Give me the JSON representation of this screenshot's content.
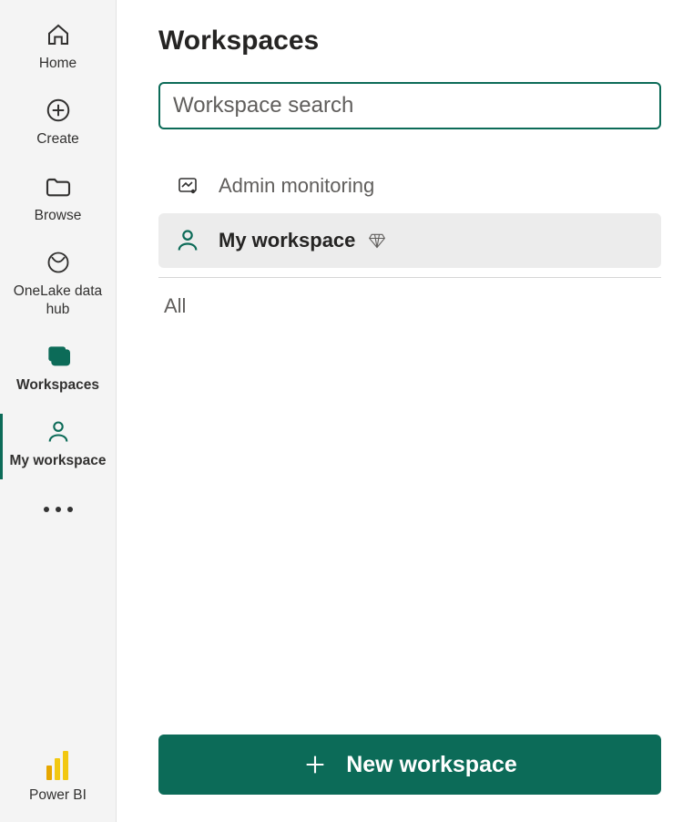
{
  "sidebar": {
    "items": [
      {
        "label": "Home"
      },
      {
        "label": "Create"
      },
      {
        "label": "Browse"
      },
      {
        "label": "OneLake data hub"
      },
      {
        "label": "Workspaces"
      },
      {
        "label": "My workspace"
      }
    ],
    "brand_label": "Power BI"
  },
  "panel": {
    "title": "Workspaces",
    "search_placeholder": "Workspace search",
    "items": [
      {
        "label": "Admin monitoring"
      },
      {
        "label": "My workspace"
      }
    ],
    "section_label": "All",
    "new_button_label": "New workspace"
  }
}
